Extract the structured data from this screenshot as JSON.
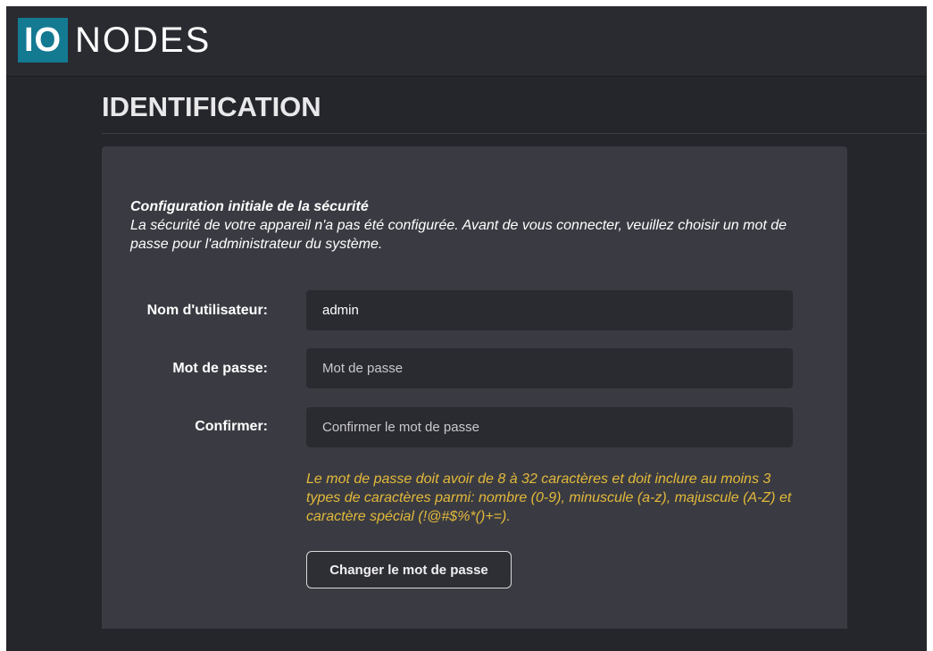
{
  "brand": {
    "logo_box_text": "IO",
    "logo_text": "NODES",
    "accent_color": "#137a92"
  },
  "page": {
    "title": "IDENTIFICATION"
  },
  "security": {
    "intro_title": "Configuration initiale de la sécurité",
    "intro_text": "La sécurité de votre appareil n'a pas été configurée. Avant de vous connecter, veuillez choisir un mot de passe pour l'administrateur du système.",
    "username": {
      "label": "Nom d'utilisateur:",
      "value": "admin"
    },
    "password": {
      "label": "Mot de passe:",
      "placeholder": "Mot de passe"
    },
    "confirm": {
      "label": "Confirmer:",
      "placeholder": "Confirmer le mot de passe"
    },
    "hint": "Le mot de passe doit avoir de 8 à 32 caractères et doit inclure au moins 3 types de caractères parmi: nombre (0-9), minuscule (a-z), majuscule (A-Z) et caractère spécial (!@#$%*()+=).",
    "hint_color": "#e3b93a",
    "submit_label": "Changer le mot de passe"
  }
}
